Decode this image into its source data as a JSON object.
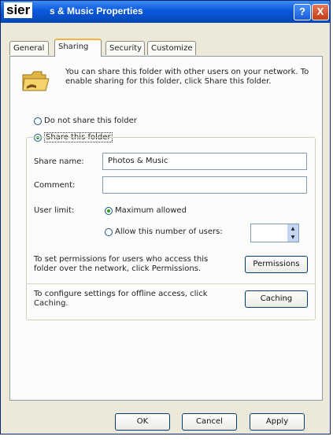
{
  "window": {
    "title_overlay": "sier",
    "title": "s & Music Properties",
    "help_label": "?",
    "close_label": "X"
  },
  "tabs": [
    "General",
    "Sharing",
    "Security",
    "Customize"
  ],
  "active_tab": "Sharing",
  "info_text": "You can share this folder with other users on your network. To enable sharing for this folder, click Share this folder.",
  "radio_no_share": "Do not share this folder",
  "radio_share": "Share this folder",
  "share_name_label": "Share name:",
  "share_name_value": "Photos & Music",
  "comment_label": "Comment:",
  "comment_value": "",
  "user_limit_label": "User limit:",
  "radio_max": "Maximum allowed",
  "radio_allow": "Allow this number of users:",
  "user_count_value": "",
  "permissions_desc": "To set permissions for users who access this folder over the network, click Permissions.",
  "permissions_button": "Permissions",
  "caching_desc": "To configure settings for offline access, click Caching.",
  "caching_button": "Caching",
  "ok_button": "OK",
  "cancel_button": "Cancel",
  "apply_button": "Apply",
  "colors": {
    "titlebar": "#0a58dc",
    "active_tab_accent": "#f3b33a",
    "radio_selected": "#21a121"
  }
}
